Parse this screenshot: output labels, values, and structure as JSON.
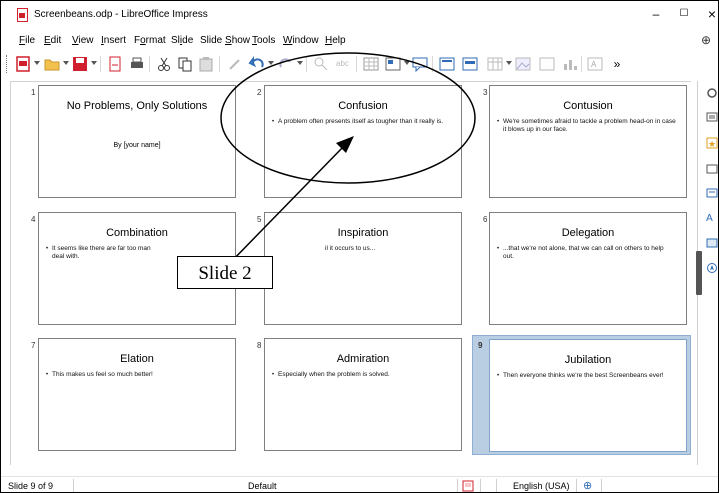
{
  "window": {
    "title": "Screenbeans.odp - LibreOffice Impress",
    "minimize": "–",
    "maximize": "☐",
    "close": "×"
  },
  "menu": [
    {
      "label": "File"
    },
    {
      "label": "Edit"
    },
    {
      "label": "View"
    },
    {
      "label": "Insert"
    },
    {
      "label": "Format"
    },
    {
      "label": "Slide"
    },
    {
      "label": "Slide Show"
    },
    {
      "label": "Tools"
    },
    {
      "label": "Window"
    },
    {
      "label": "Help"
    }
  ],
  "toolbar": {
    "more": "»"
  },
  "slides": [
    {
      "number": "1",
      "title": "No Problems, Only Solutions",
      "subtitle": "By [your name]",
      "body": ""
    },
    {
      "number": "2",
      "title": "Confusion",
      "subtitle": "",
      "body": "A problem often presents itself as tougher than it really is."
    },
    {
      "number": "3",
      "title": "Contusion",
      "subtitle": "",
      "body": "We're sometimes afraid to tackle a problem head-on in case it blows up in our face."
    },
    {
      "number": "4",
      "title": "Combination",
      "subtitle": "",
      "body": "It seems like there are far too man"
    },
    {
      "number": "5",
      "title": "Inspiration",
      "subtitle": "",
      "body": "il it occurs to us..."
    },
    {
      "number": "6",
      "title": "Delegation",
      "subtitle": "",
      "body": "...that we're not alone, that we can call on others to help out."
    },
    {
      "number": "7",
      "title": "Elation",
      "subtitle": "",
      "body": "This makes us feel so much better!"
    },
    {
      "number": "8",
      "title": "Admiration",
      "subtitle": "",
      "body": "Especially when the problem is solved."
    },
    {
      "number": "9",
      "title": "Jubilation",
      "subtitle": "",
      "body": "Then everyone thinks we're the best Screenbeans ever!"
    }
  ],
  "slide4_extra": "deal with.",
  "selected_slide": "9",
  "callout": {
    "label": "Slide 2"
  },
  "status": {
    "slide_position": "Slide 9 of 9",
    "master": "Default",
    "language": "English (USA)"
  },
  "colors": {
    "accent_red": "#d0202c",
    "selection": "#b9cde3",
    "toolbar_blue": "#2f6cb5"
  }
}
